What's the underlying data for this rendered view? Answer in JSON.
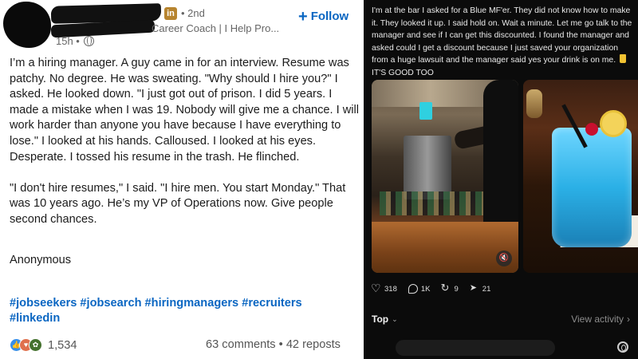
{
  "linkedin": {
    "logo_letters": "in",
    "degree": "• 2nd",
    "headline": "Career Coach | I Help Pro...",
    "time": "15h •",
    "follow_label": "Follow",
    "post_paragraphs": [
      "I’m a hiring manager. A guy came in for an interview. Resume was patchy. No degree. He was sweating. \"Why should I hire you?\" I asked. He looked down. \"I just got out of prison. I did 5 years. I made a mistake when I was 19. Nobody will give me a chance. I will work harder than anyone you have because I have everything to lose.\" I looked at his hands. Calloused. I looked at his eyes. Desperate. I tossed his resume in the trash. He flinched.",
      "\"I don't hire resumes,\" I said. \"I hire men. You start Monday.\" That was 10 years ago. He’s my VP of Operations now. Give people second chances."
    ],
    "signature": "Anonymous",
    "hashtags": "#jobseekers #jobsearch #hiringmanagers #recruiters #linkedin",
    "reaction_count": "1,534",
    "comments_reposts": "63 comments • 42 reposts"
  },
  "threads": {
    "post_text_part1": "I'm at the bar I asked for a Blue MF'er. They did not know how to make it. They looked it up. I said hold on. Wait a minute. Let me go talk to the manager and see if I can get this discounted. I found the manager and asked could I get a discount because I just saved your organization from a huge lawsuit and the manager said yes your drink is on me.",
    "post_text_part2": "IT'S GOOD TOO",
    "likes": "318",
    "comments": "1K",
    "reposts": "9",
    "shares": "21",
    "top_label": "Top",
    "view_activity": "View activity"
  },
  "icons": {
    "follow": "plus-icon",
    "visibility": "globe-icon",
    "emoji": "beer-icon",
    "mute": "mute-icon",
    "like": "heart-icon",
    "comment": "comment-icon",
    "repost": "repost-icon",
    "share": "send-icon",
    "brand": "threads-logo-icon"
  },
  "colors": {
    "linkedin_blue": "#0a66c2",
    "threads_bg": "#0b0b0b"
  }
}
